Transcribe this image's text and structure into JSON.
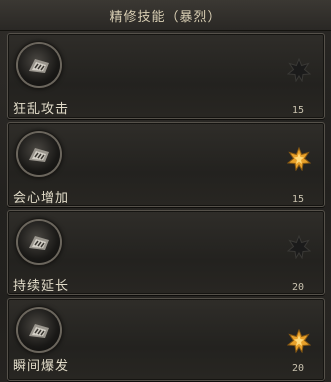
{
  "window": {
    "title": "精修技能（暴烈）"
  },
  "skills": [
    {
      "name": "狂乱攻击",
      "level": "15",
      "star_icon": "star-dark-icon",
      "star_active": false
    },
    {
      "name": "会心增加",
      "level": "15",
      "star_icon": "star-gold-icon",
      "star_active": true
    },
    {
      "name": "持续延长",
      "level": "20",
      "star_icon": "star-dark-icon",
      "star_active": false
    },
    {
      "name": "瞬间爆发",
      "level": "20",
      "star_icon": "star-gold-icon",
      "star_active": true
    }
  ],
  "colors": {
    "star_gold": "#e8a12a",
    "star_dark": "#1b1b1b",
    "title_text": "#d9cfb4"
  }
}
